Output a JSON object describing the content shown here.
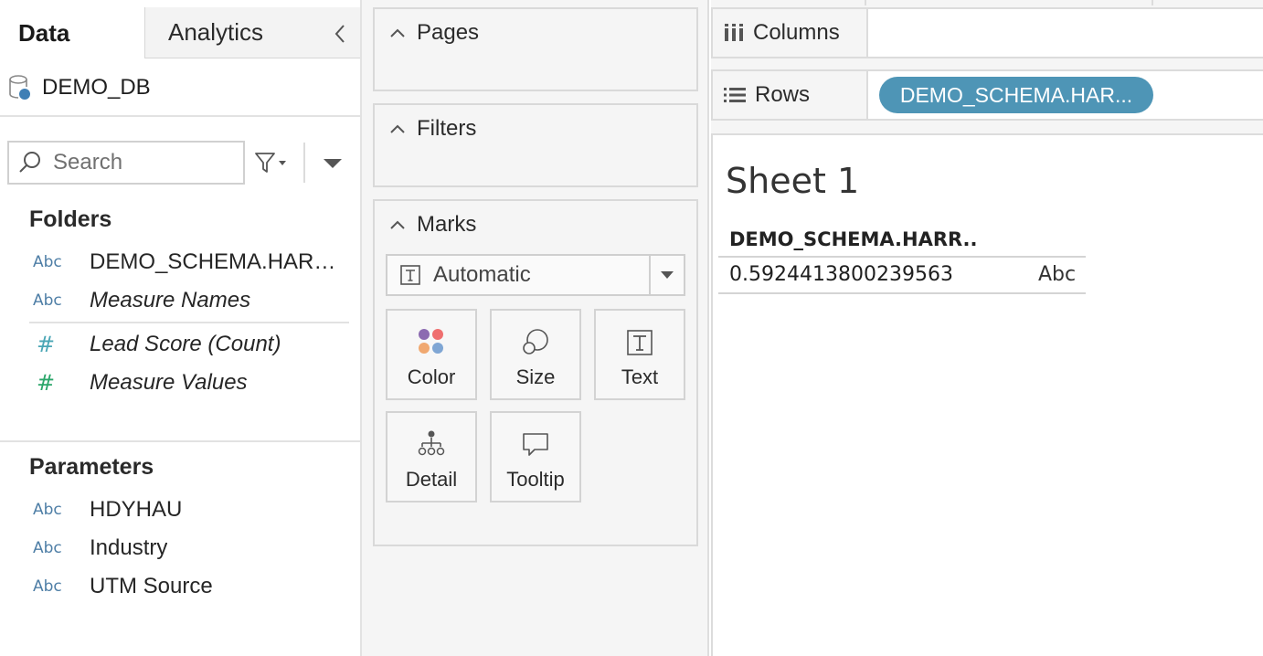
{
  "left_pane": {
    "tabs": {
      "data": "Data",
      "analytics": "Analytics"
    },
    "datasource": "DEMO_DB",
    "search": {
      "placeholder": "Search"
    },
    "folders_title": "Folders",
    "fields": [
      {
        "icon": "Abc",
        "name": "DEMO_SCHEMA.HARR...",
        "italic": false
      },
      {
        "icon": "Abc",
        "name": "Measure Names",
        "italic": true
      },
      {
        "icon": "#",
        "name": "Lead Score (Count)",
        "italic": true
      },
      {
        "icon": "#",
        "name": "Measure Values",
        "italic": true
      }
    ],
    "parameters_title": "Parameters",
    "parameters": [
      {
        "icon": "Abc",
        "name": "HDYHAU"
      },
      {
        "icon": "Abc",
        "name": "Industry"
      },
      {
        "icon": "Abc",
        "name": "UTM Source"
      }
    ]
  },
  "cards": {
    "pages": "Pages",
    "filters": "Filters",
    "marks": {
      "title": "Marks",
      "type": "Automatic",
      "buttons": {
        "color": "Color",
        "size": "Size",
        "text": "Text",
        "detail": "Detail",
        "tooltip": "Tooltip"
      }
    }
  },
  "shelves": {
    "columns": "Columns",
    "rows": "Rows",
    "rows_pill": "DEMO_SCHEMA.HAR..."
  },
  "sheet": {
    "title": "Sheet 1",
    "column_header": "DEMO_SCHEMA.HARR..",
    "row_value": "0.5924413800239563",
    "row_type": "Abc"
  },
  "colors": {
    "pill": "#4e95b6",
    "abc_icon": "#4e7ea6",
    "measure_icon": "#2ba66a",
    "dimension_icon": "#4aa6b5"
  }
}
